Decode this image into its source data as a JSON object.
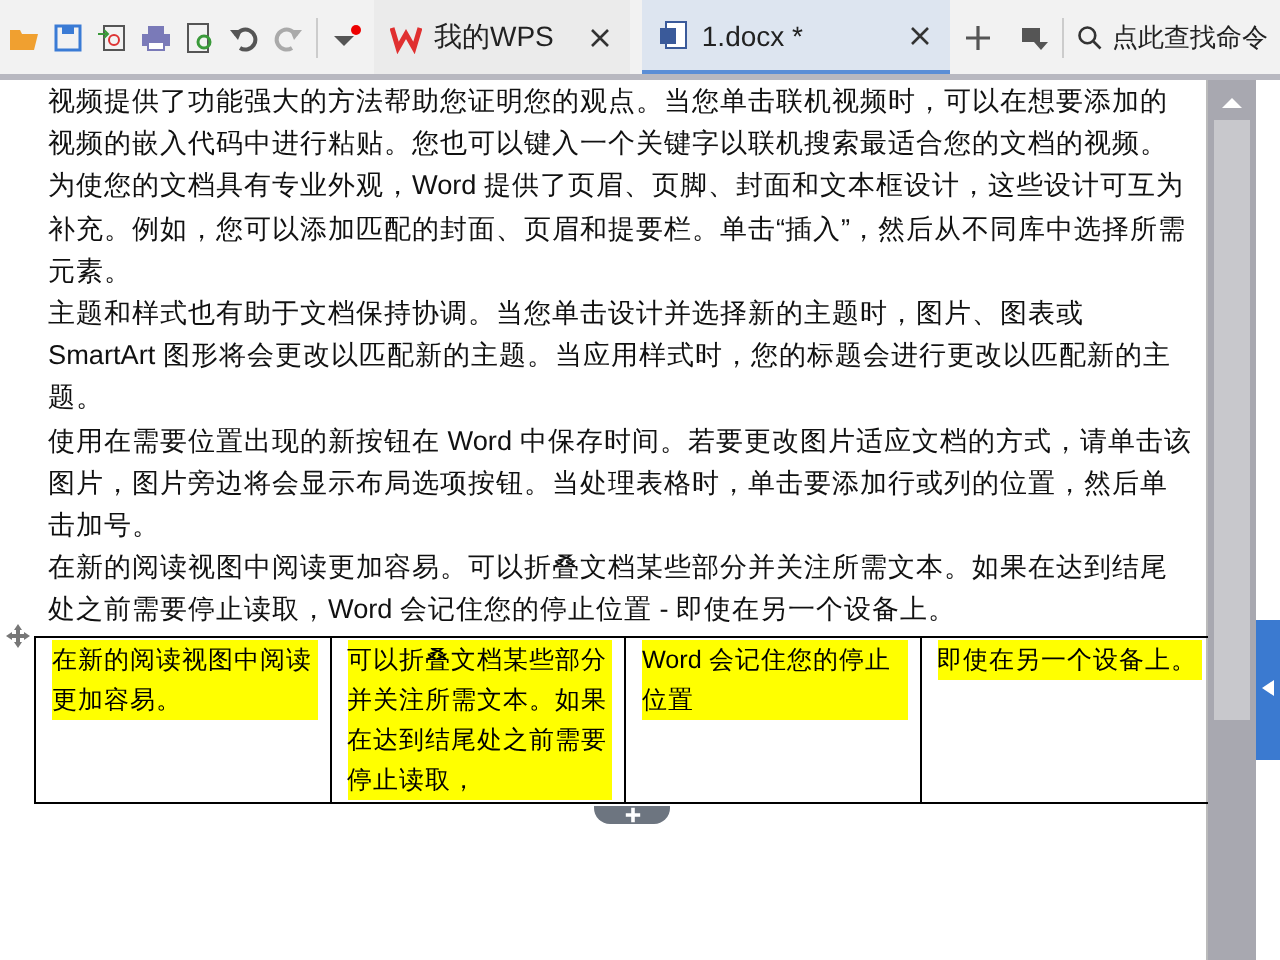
{
  "tabs": [
    {
      "label": "我的WPS",
      "selected": false,
      "kind": "home"
    },
    {
      "label": "1.docx *",
      "selected": true,
      "kind": "doc"
    }
  ],
  "search": {
    "placeholder": "点此查找命令"
  },
  "document": {
    "paragraphs": [
      "视频提供了功能强大的方法帮助您证明您的观点。当您单击联机视频时，可以在想要添加的视频的嵌入代码中进行粘贴。您也可以键入一个关键字以联机搜索最适合您的文档的视频。",
      "为使您的文档具有专业外观，Word 提供了页眉、页脚、封面和文本框设计，这些设计可互为补充。例如，您可以添加匹配的封面、页眉和提要栏。单击“插入”，然后从不同库中选择所需元素。",
      "主题和样式也有助于文档保持协调。当您单击设计并选择新的主题时，图片、图表或 SmartArt 图形将会更改以匹配新的主题。当应用样式时，您的标题会进行更改以匹配新的主题。",
      "使用在需要位置出现的新按钮在 Word 中保存时间。若要更改图片适应文档的方式，请单击该图片，图片旁边将会显示布局选项按钮。当处理表格时，单击要添加行或列的位置，然后单击加号。",
      "在新的阅读视图中阅读更加容易。可以折叠文档某些部分并关注所需文本。如果在达到结尾处之前需要停止读取，Word 会记住您的停止位置 - 即使在另一个设备上。"
    ],
    "table": {
      "cells": [
        "在新的阅读视图中阅读更加容易。",
        "可以折叠文档某些部分并关注所需文本。如果在达到结尾处之前需要停止读取，",
        "Word 会记住您的停止位置",
        "即使在另一个设备上。"
      ]
    }
  }
}
